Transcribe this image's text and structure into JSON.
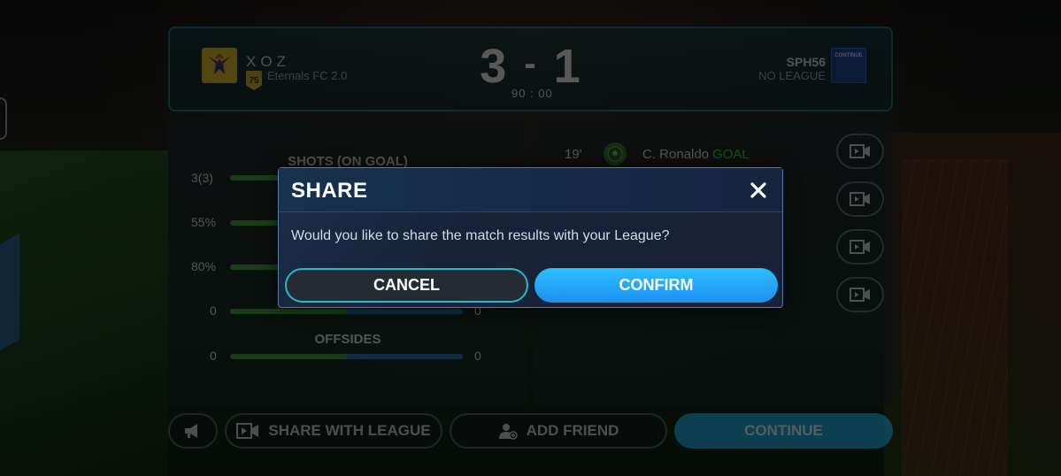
{
  "scoreboard": {
    "home_name": "XOZ",
    "home_sub": "Eternals FC 2.0",
    "home_rating": "75",
    "home_score": "3",
    "separator": "-",
    "away_score": "1",
    "time": "90 : 00",
    "away_name": "SPH56",
    "away_sub": "NO LEAGUE",
    "away_logo_text": "CONTINUE"
  },
  "stats": [
    {
      "title": "SHOTS (ON GOAL)",
      "left": "3(3)",
      "right": ""
    },
    {
      "title": "",
      "left": "55%",
      "right": ""
    },
    {
      "title": "",
      "left": "80%",
      "right": ""
    },
    {
      "title": "",
      "left": "0",
      "right": "0"
    },
    {
      "title": "OFFSIDES",
      "left": "0",
      "right": "0"
    }
  ],
  "events": [
    {
      "minute": "19'",
      "player": "C. Ronaldo",
      "type": "GOAL"
    }
  ],
  "bottom_bar": {
    "share_label": "SHARE WITH LEAGUE",
    "add_friend_label": "ADD FRIEND",
    "continue_label": "CONTINUE"
  },
  "modal": {
    "title": "SHARE",
    "message": "Would you like to share the match results with your League?",
    "cancel_label": "CANCEL",
    "confirm_label": "CONFIRM"
  },
  "colors": {
    "accent": "#1aa0d8",
    "goal": "#2ecc40",
    "cancel_border": "#2bb9c9"
  },
  "icons": [
    "close-icon",
    "video-icon",
    "megaphone-icon",
    "add-user-icon",
    "soccer-ball-icon"
  ]
}
